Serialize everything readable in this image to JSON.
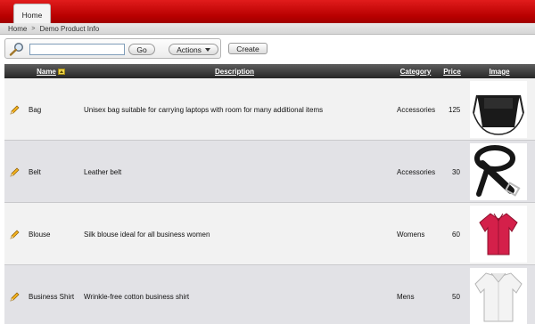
{
  "tabs": {
    "home": "Home"
  },
  "breadcrumb": {
    "root": "Home",
    "current": "Demo Product Info"
  },
  "toolbar": {
    "search_value": "",
    "go_label": "Go",
    "actions_label": "Actions",
    "create_label": "Create"
  },
  "table": {
    "headers": {
      "name": "Name",
      "description": "Description",
      "category": "Category",
      "price": "Price",
      "image": "Image"
    },
    "rows": [
      {
        "name": "Bag",
        "description": "Unisex bag suitable for carrying laptops with room for many additional items",
        "category": "Accessories",
        "price": "125",
        "image_icon": "bag-image"
      },
      {
        "name": "Belt",
        "description": "Leather belt",
        "category": "Accessories",
        "price": "30",
        "image_icon": "belt-image"
      },
      {
        "name": "Blouse",
        "description": "Silk blouse ideal for all business women",
        "category": "Womens",
        "price": "60",
        "image_icon": "blouse-image"
      },
      {
        "name": "Business Shirt",
        "description": "Wrinkle-free cotton business shirt",
        "category": "Mens",
        "price": "50",
        "image_icon": "shirt-image"
      }
    ]
  },
  "colors": {
    "header_red": "#c00000",
    "table_header": "#3a3a3a",
    "row_odd": "#f2f2f2",
    "row_even": "#e2e2e6"
  }
}
